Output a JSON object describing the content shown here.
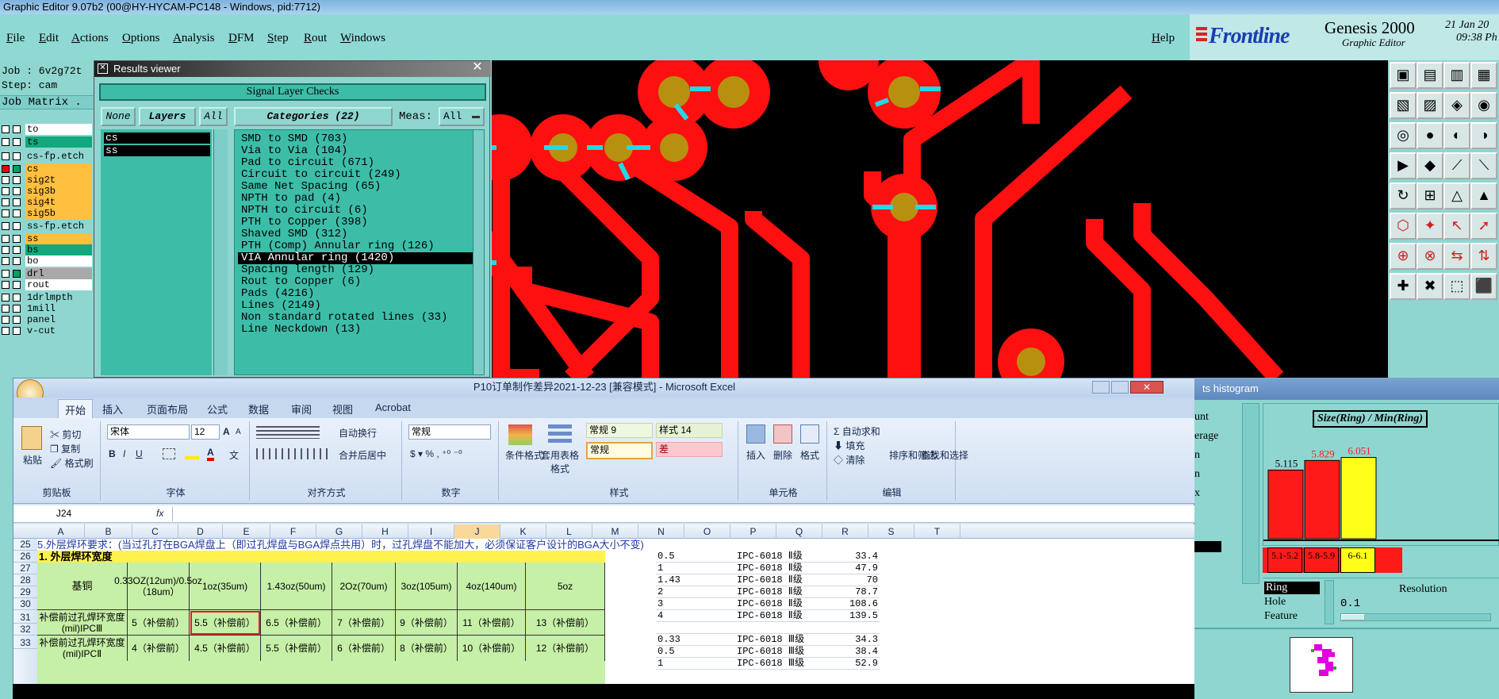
{
  "window": {
    "title": "Graphic Editor 9.07b2 (00@HY-HYCAM-PC148 - Windows, pid:7712)"
  },
  "menu": [
    "File",
    "Edit",
    "Actions",
    "Options",
    "Analysis",
    "DFM",
    "Step",
    "Rout",
    "Windows"
  ],
  "help": "Help",
  "brand": {
    "logo": "Frontline",
    "product": "Genesis 2000",
    "subtitle": "Graphic Editor",
    "date": "21 Jan 20",
    "time": "09:38 Ph"
  },
  "job": {
    "job_label": "Job : 6v2g72t",
    "step_label": "Step: cam",
    "matrix_label": "Job Matrix ."
  },
  "layers": [
    {
      "name": "to",
      "color": "#ffffff"
    },
    {
      "name": "ts",
      "color": "#10a87c"
    },
    {
      "name": "cs-fp.etch",
      "color": "#8fd6d0"
    },
    {
      "name": "cs",
      "color": "#ffbf3f"
    },
    {
      "name": "sig2t",
      "color": "#ffbf3f"
    },
    {
      "name": "sig3b",
      "color": "#ffbf3f"
    },
    {
      "name": "sig4t",
      "color": "#ffbf3f"
    },
    {
      "name": "sig5b",
      "color": "#ffbf3f"
    },
    {
      "name": "ss-fp.etch",
      "color": "#8fd6d0"
    },
    {
      "name": "ss",
      "color": "#ffbf3f"
    },
    {
      "name": "bs",
      "color": "#10a87c"
    },
    {
      "name": "bo",
      "color": "#ffffff"
    },
    {
      "name": "drl",
      "color": "#a8a8a8"
    },
    {
      "name": "rout",
      "color": "#ffffff"
    },
    {
      "name": "1drlmpth",
      "color": "#8fd6d0"
    },
    {
      "name": "1mill",
      "color": "#8fd6d0"
    },
    {
      "name": "panel",
      "color": "#8fd6d0"
    },
    {
      "name": "v-cut",
      "color": "#8fd6d0"
    }
  ],
  "results_viewer": {
    "title": "Results viewer",
    "header": "Signal Layer Checks",
    "none_btn": "None",
    "layers_btn": "Layers",
    "all_btn": "All",
    "categories_btn": "Categories (22)",
    "meas_label": "Meas:",
    "meas_value": "All",
    "layer_items": [
      "cs",
      "ss"
    ],
    "categories": [
      "SMD to SMD (703)",
      "Via to Via (104)",
      "Pad to circuit (671)",
      "Circuit to circuit (249)",
      "Same Net Spacing (65)",
      "NPTH to pad (4)",
      "NPTH to circuit (6)",
      "PTH to Copper (398)",
      "Shaved SMD (312)",
      "PTH (Comp) Annular ring (126)",
      "VIA Annular ring (1420)",
      "Spacing length (129)",
      "Rout to Copper (6)",
      "Pads (4216)",
      "Lines (2149)",
      "Non standard rotated lines (33)",
      "Line Neckdown (13)"
    ],
    "selected_index": 10
  },
  "excel": {
    "title": "P10订单制作差异2021-12-23 [兼容模式] - Microsoft Excel",
    "tabs": [
      "开始",
      "插入",
      "页面布局",
      "公式",
      "数据",
      "审阅",
      "视图",
      "Acrobat"
    ],
    "clipboard": {
      "paste": "粘贴",
      "cut": "剪切",
      "copy": "复制",
      "format_painter": "格式刷",
      "label": "剪贴板"
    },
    "font": {
      "name": "宋体",
      "size": "12",
      "label": "字体"
    },
    "align": {
      "wrap": "自动换行",
      "merge": "合并后居中",
      "label": "对齐方式"
    },
    "number": {
      "format": "常规",
      "label": "数字"
    },
    "styles": {
      "cond": "条件格式",
      "table": "套用表格格式",
      "normal9": "常规 9",
      "style14": "样式 14",
      "normal": "常规",
      "bad": "差",
      "label": "样式"
    },
    "cells": {
      "insert": "插入",
      "delete": "删除",
      "format": "格式",
      "label": "单元格"
    },
    "edit": {
      "autosum": "自动求和",
      "fill": "填充",
      "clear": "清除",
      "sort": "排序和筛选",
      "find": "查找和选择",
      "label": "编辑"
    },
    "namebox": "J24",
    "fx": "fx",
    "columns": [
      "A",
      "B",
      "C",
      "D",
      "E",
      "F",
      "G",
      "H",
      "I",
      "J",
      "K",
      "L",
      "M",
      "N",
      "O",
      "P",
      "Q",
      "R",
      "S",
      "T"
    ],
    "rows": [
      "25",
      "26",
      "27",
      "28",
      "29",
      "30",
      "31",
      "32",
      "33"
    ],
    "r25": "5.外层焊环要求：(当过孔打在BGA焊盘上（即过孔焊盘与BGA焊点共用）时，过孔焊盘不能加大，必须保证客户设计的BGA大小不变)",
    "r26": "1. 外层焊环宽度",
    "header_base": "基铜",
    "header_cols": [
      "0.33OZ(12um)/0.5oz（18um）",
      "1oz(35um)",
      "1.43oz(50um)",
      "2Oz(70um)",
      "3oz(105um)",
      "4oz(140um)",
      "5oz"
    ],
    "row30_label": "补偿前过孔焊环宽度(mil)IPCⅢ",
    "row30": [
      "5（补偿前）",
      "5.5（补偿前）",
      "6.5（补偿前）",
      "7（补偿前）",
      "9（补偿前）",
      "11（补偿前）",
      "13（补偿前）"
    ],
    "row32_label": "补偿前过孔焊环宽度(mil)IPCⅡ",
    "row32": [
      "4（补偿前）",
      "4.5（补偿前）",
      "5.5（补偿前）",
      "6（补偿前）",
      "8（补偿前）",
      "10（补偿前）",
      "12（补偿前）"
    ],
    "side_table": [
      [
        "0.5",
        "IPC-6018 Ⅱ级",
        "33.4"
      ],
      [
        "1",
        "IPC-6018 Ⅱ级",
        "47.9"
      ],
      [
        "1.43",
        "IPC-6018 Ⅱ级",
        "70"
      ],
      [
        "2",
        "IPC-6018 Ⅱ级",
        "78.7"
      ],
      [
        "3",
        "IPC-6018 Ⅱ级",
        "108.6"
      ],
      [
        "4",
        "IPC-6018 Ⅱ级",
        "139.5"
      ],
      [
        "",
        "",
        ""
      ],
      [
        "0.33",
        "IPC-6018 Ⅲ级",
        "34.3"
      ],
      [
        "0.5",
        "IPC-6018 Ⅲ级",
        "38.4"
      ],
      [
        "1",
        "IPC-6018 Ⅲ级",
        "52.9"
      ]
    ]
  },
  "histogram": {
    "title": "ts histogram",
    "chart_title": "Size(Ring) / Min(Ring)",
    "labels_left": [
      "unt",
      "erage",
      "n",
      "n",
      "x"
    ],
    "bars": [
      {
        "range": "5.1-5.2",
        "value": 5.115,
        "color": "#ff1a1a",
        "label_color": "#000000"
      },
      {
        "range": "5.8-5.9",
        "value": 5.829,
        "color": "#ff1a1a",
        "label_color": "#ff1a1a"
      },
      {
        "range": "6-6.1",
        "value": 6.051,
        "color": "#ffff1a",
        "label_color": "#ff1a1a"
      }
    ],
    "options": [
      "Ring",
      "Hole",
      "Feature"
    ],
    "resolution_label": "Resolution",
    "resolution_value": "0.1"
  }
}
